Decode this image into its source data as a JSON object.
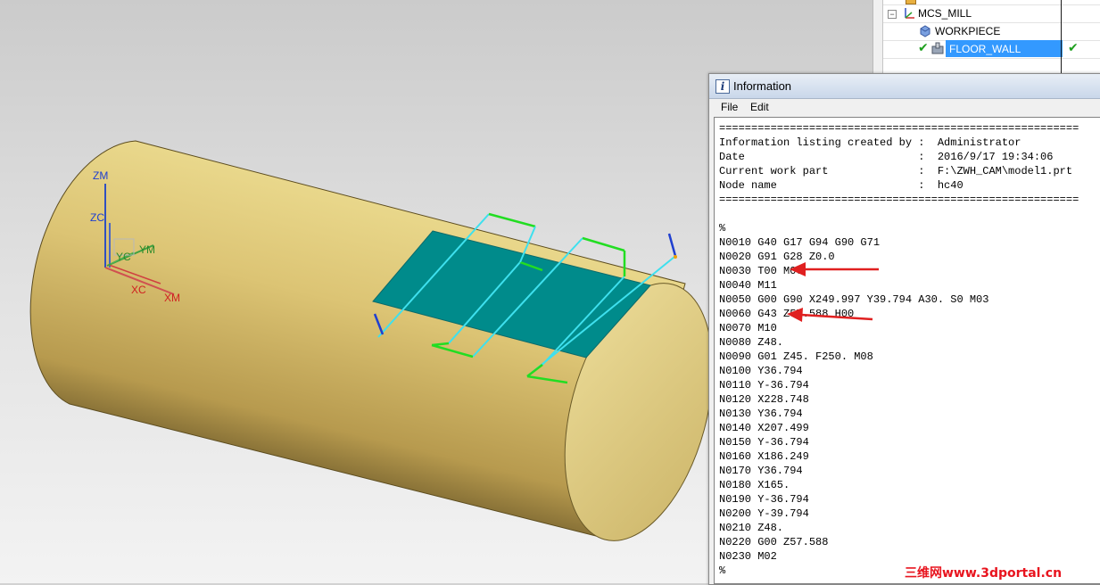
{
  "navigator": {
    "rows": [
      {
        "label": "MCS_MILL",
        "icon": "mcs-axes-icon"
      },
      {
        "label": "WORKPIECE",
        "icon": "workpiece-icon"
      },
      {
        "label": "FLOOR_WALL",
        "icon": "operation-icon",
        "selected": true,
        "status": "complete"
      }
    ]
  },
  "viewport": {
    "axis_labels": {
      "zm": "ZM",
      "zc": "ZC",
      "yc": "YC",
      "ym": "YM",
      "xc": "XC",
      "xm": "XM"
    },
    "colors": {
      "part": "#c9b160",
      "floor": "#008b8b",
      "toolpath_cut": "#3ee0ee",
      "toolpath_move": "#22dd22",
      "annotation_arrow": "#e02020"
    }
  },
  "info_window": {
    "title": "Information",
    "menu": [
      "File",
      "Edit"
    ],
    "lines": [
      "========================================================",
      "Information listing created by :  Administrator",
      "Date                           :  2016/9/17 19:34:06",
      "Current work part              :  F:\\ZWH_CAM\\model1.prt",
      "Node name                      :  hc40",
      "========================================================",
      "",
      "%",
      "N0010 G40 G17 G94 G90 G71",
      "N0020 G91 G28 Z0.0",
      "N0030 T00 M06",
      "N0040 M11",
      "N0050 G00 G90 X249.997 Y39.794 A30. S0 M03",
      "N0060 G43 Z57.588 H00",
      "N0070 M10",
      "N0080 Z48.",
      "N0090 G01 Z45. F250. M08",
      "N0100 Y36.794",
      "N0110 Y-36.794",
      "N0120 X228.748",
      "N0130 Y36.794",
      "N0140 X207.499",
      "N0150 Y-36.794",
      "N0160 X186.249",
      "N0170 Y36.794",
      "N0180 X165.",
      "N0190 Y-36.794",
      "N0200 Y-39.794",
      "N0210 Z48.",
      "N0220 G00 Z57.588",
      "N0230 M02",
      "%"
    ]
  },
  "watermark": "三维网www.3dportal.cn"
}
